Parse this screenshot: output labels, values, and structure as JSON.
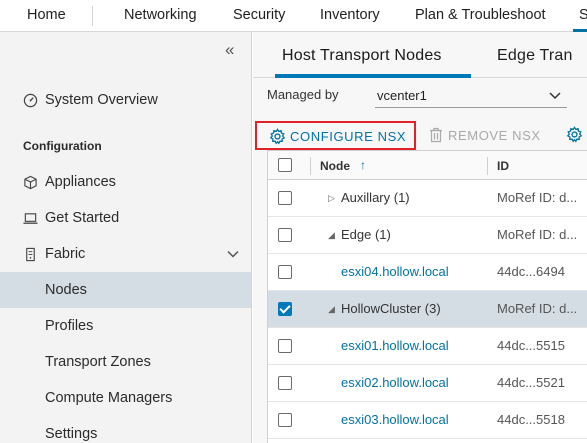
{
  "topnav": {
    "tabs": [
      {
        "label": "Home"
      },
      {
        "label": "Networking"
      },
      {
        "label": "Security"
      },
      {
        "label": "Inventory"
      },
      {
        "label": "Plan & Troubleshoot"
      },
      {
        "label": "S"
      }
    ]
  },
  "sidebar": {
    "collapse_glyph": "«",
    "system_overview": "System Overview",
    "configuration_title": "Configuration",
    "appliances": "Appliances",
    "get_started": "Get Started",
    "fabric": "Fabric",
    "fabric_children": [
      {
        "label": "Nodes",
        "selected": true
      },
      {
        "label": "Profiles"
      },
      {
        "label": "Transport Zones"
      },
      {
        "label": "Compute Managers"
      },
      {
        "label": "Settings"
      }
    ]
  },
  "main": {
    "tabs": [
      {
        "label": "Host Transport Nodes",
        "active": true
      },
      {
        "label": "Edge Tran"
      }
    ],
    "managed_by_label": "Managed by",
    "managed_by_value": "vcenter1",
    "toolbar": {
      "configure_label": "CONFIGURE NSX",
      "remove_label": "REMOVE NSX"
    },
    "grid": {
      "columns": {
        "node": "Node",
        "id": "ID",
        "sort_glyph": "↑"
      },
      "rows": [
        {
          "node": "Auxillary (1)",
          "id": "MoRef ID: d...",
          "kind": "group",
          "expander": "▷",
          "checked": false
        },
        {
          "node": "Edge (1)",
          "id": "MoRef ID: d...",
          "kind": "group",
          "expander": "◢",
          "checked": false
        },
        {
          "node": "esxi04.hollow.local",
          "id": "44dc...6494",
          "kind": "link",
          "checked": false
        },
        {
          "node": "HollowCluster (3)",
          "id": "MoRef ID: d...",
          "kind": "group",
          "expander": "◢",
          "checked": true
        },
        {
          "node": "esxi01.hollow.local",
          "id": "44dc...5515",
          "kind": "link",
          "checked": false
        },
        {
          "node": "esxi02.hollow.local",
          "id": "44dc...5521",
          "kind": "link",
          "checked": false
        },
        {
          "node": "esxi03.hollow.local",
          "id": "44dc...5518",
          "kind": "link",
          "checked": false
        }
      ]
    }
  },
  "colors": {
    "accent": "#0072a3",
    "highlight_border": "#e12127",
    "selected_row": "#d4dde3",
    "sidebar_bg": "#f3f3f3"
  },
  "icons": {
    "system_overview": "dashboard-gauge-icon",
    "appliances": "cube-icon",
    "get_started": "laptop-icon",
    "fabric": "server-rack-icon",
    "configure": "gear-icon",
    "remove": "trash-icon",
    "more": "gear-icon"
  }
}
